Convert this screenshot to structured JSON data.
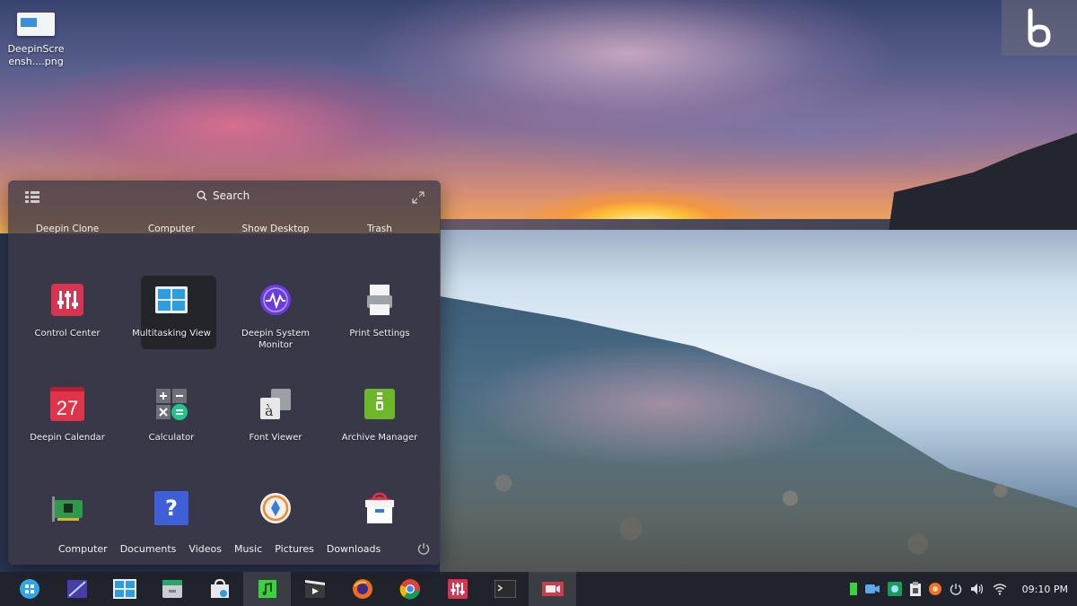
{
  "desktop": {
    "file": {
      "name": "DeepinScre ensh....png",
      "icon": "image-file-icon"
    }
  },
  "watermark": {
    "logo": "b",
    "tagline": ""
  },
  "launcher": {
    "search_label": "Search",
    "top_items": [
      {
        "label": "Deepin Clone"
      },
      {
        "label": "Computer"
      },
      {
        "label": "Show Desktop"
      },
      {
        "label": "Trash"
      }
    ],
    "apps": [
      {
        "label": "Control Center",
        "icon": "control-center-icon",
        "selected": false
      },
      {
        "label": "Multitasking View",
        "icon": "multitasking-view-icon",
        "selected": true
      },
      {
        "label": "Deepin System Monitor",
        "icon": "system-monitor-icon",
        "selected": false
      },
      {
        "label": "Print Settings",
        "icon": "printer-icon",
        "selected": false
      },
      {
        "label": "Deepin Calendar",
        "icon": "calendar-icon",
        "calendar_day": "27",
        "selected": false
      },
      {
        "label": "Calculator",
        "icon": "calculator-icon",
        "selected": false
      },
      {
        "label": "Font Viewer",
        "icon": "font-viewer-icon",
        "selected": false
      },
      {
        "label": "Archive Manager",
        "icon": "archive-manager-icon",
        "selected": false
      },
      {
        "label": "",
        "icon": "hardware-card-icon",
        "selected": false
      },
      {
        "label": "",
        "icon": "help-icon",
        "help_glyph": "?",
        "selected": false
      },
      {
        "label": "",
        "icon": "browser-compass-icon",
        "selected": false
      },
      {
        "label": "",
        "icon": "app-store-icon",
        "selected": false
      }
    ],
    "bottom_links": [
      {
        "label": "Computer"
      },
      {
        "label": "Documents"
      },
      {
        "label": "Videos"
      },
      {
        "label": "Music"
      },
      {
        "label": "Pictures"
      },
      {
        "label": "Downloads"
      }
    ]
  },
  "taskbar": {
    "apps": [
      {
        "icon": "launcher-icon",
        "active": false
      },
      {
        "icon": "screenshot-icon",
        "active": false
      },
      {
        "icon": "multitasking-view-icon",
        "active": false
      },
      {
        "icon": "file-manager-icon",
        "active": false
      },
      {
        "icon": "app-store-icon",
        "active": false
      },
      {
        "icon": "music-player-icon",
        "active": true
      },
      {
        "icon": "movie-player-icon",
        "active": false
      },
      {
        "icon": "firefox-icon",
        "active": false
      },
      {
        "icon": "chrome-icon",
        "active": false
      },
      {
        "icon": "control-center-icon",
        "active": false
      },
      {
        "icon": "terminal-icon",
        "active": false
      },
      {
        "icon": "screen-recorder-icon",
        "active": true
      }
    ],
    "tray": [
      {
        "icon": "battery-indicator-icon"
      },
      {
        "icon": "camera-icon"
      },
      {
        "icon": "image-viewer-icon"
      },
      {
        "icon": "clipboard-icon"
      },
      {
        "icon": "shutdown-indicator-icon"
      },
      {
        "icon": "power-icon"
      },
      {
        "icon": "volume-icon"
      },
      {
        "icon": "wifi-icon"
      }
    ],
    "clock": "09:10 PM"
  }
}
